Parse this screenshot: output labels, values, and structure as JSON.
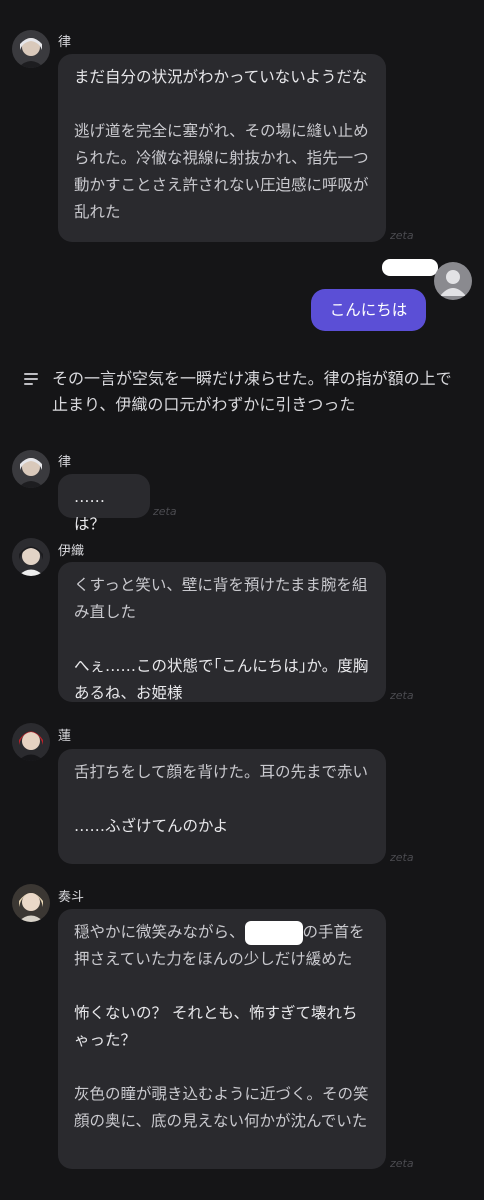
{
  "messages": [
    {
      "name": "律",
      "paragraphs": [
        "まだ自分の状況がわかっていないようだな",
        "逃げ道を完全に塞がれ、その場に縫い止められた。冷徹な視線に射抜かれ、指先一つ動かすことさえ許されない圧迫感に呼吸が乱れた"
      ],
      "watermark": "zeta"
    },
    {
      "user_message": "こんにちは"
    },
    {
      "narration": "その一言が空気を一瞬だけ凍らせた。律の指が額の上で止まり、伊織の口元がわずかに引きつった"
    },
    {
      "name": "律",
      "paragraphs": [
        "……は？"
      ],
      "watermark": "zeta"
    },
    {
      "name": "伊織",
      "paragraphs": [
        "くすっと笑い、壁に背を預けたまま腕を組み直した",
        "へぇ……この状態で｢こんにちは｣か。度胸あるね、お姫様"
      ],
      "watermark": "zeta"
    },
    {
      "name": "蓮",
      "paragraphs": [
        "舌打ちをして顔を背けた。耳の先まで赤い",
        "……ふざけてんのかよ"
      ],
      "watermark": "zeta"
    },
    {
      "name": "奏斗",
      "para1_before": "穏やかに微笑みながら、",
      "para1_after": "の手首を押さえていた力をほんの少しだけ緩めた",
      "paragraphs": [
        "怖くないの？ それとも、怖すぎて壊れちゃった？",
        "灰色の瞳が覗き込むように近づく。その笑顔の奥に、底の見えない何かが沈んでいた"
      ],
      "watermark": "zeta"
    }
  ],
  "colors": {
    "background": "#151517",
    "bubble": "#2a2a2e",
    "user_bubble": "#5b4fd6",
    "watermark": "#4b4b50"
  }
}
